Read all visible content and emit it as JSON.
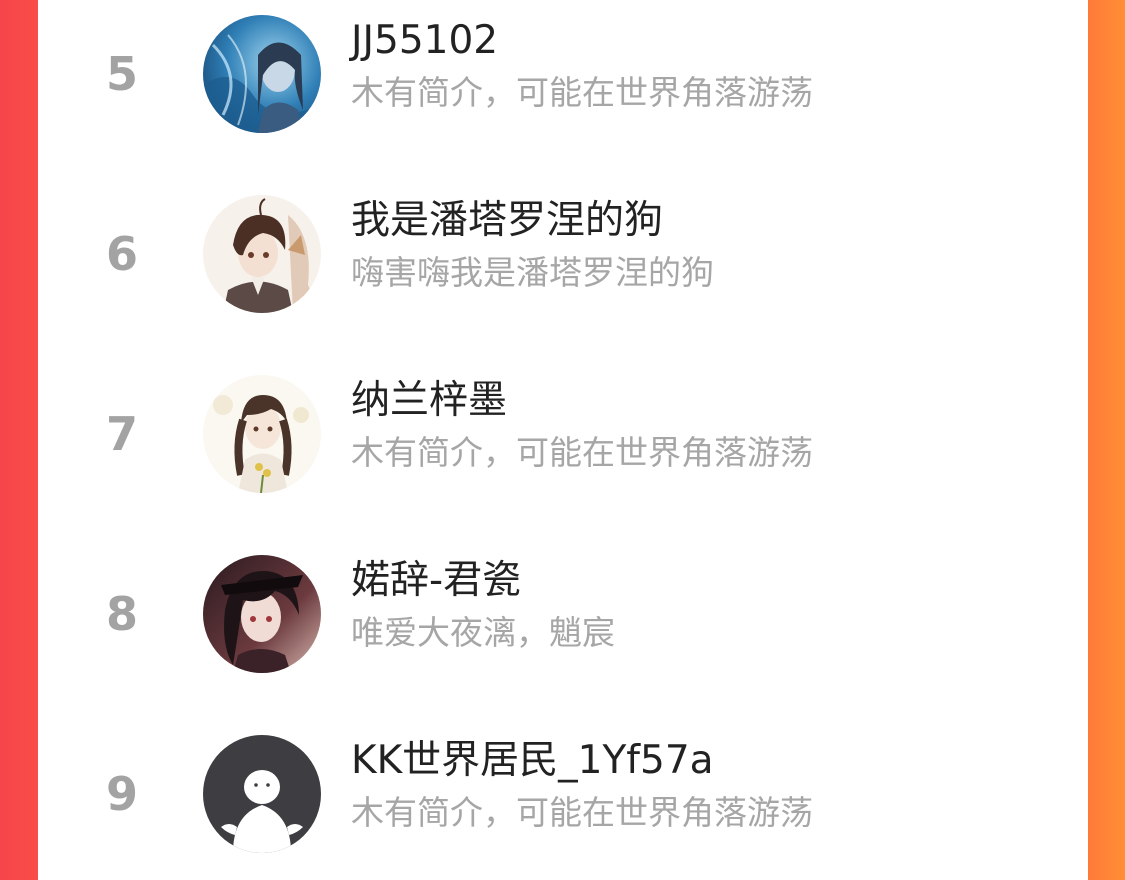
{
  "ranking": {
    "items": [
      {
        "rank": "5",
        "name": "JJ55102",
        "bio": "木有简介，可能在世界角落游荡",
        "avatar": "anime-avatar-blue-icon"
      },
      {
        "rank": "6",
        "name": "我是潘塔罗涅的狗",
        "bio": "嗨害嗨我是潘塔罗涅的狗",
        "avatar": "anime-avatar-boy-icon"
      },
      {
        "rank": "7",
        "name": "纳兰梓墨",
        "bio": "木有简介，可能在世界角落游荡",
        "avatar": "anime-avatar-girl-icon"
      },
      {
        "rank": "8",
        "name": "婼辞-君瓷",
        "bio": "唯爱大夜漓，魈宸",
        "avatar": "anime-avatar-dark-icon"
      },
      {
        "rank": "9",
        "name": "KK世界居民_1Yf57a",
        "bio": "木有简介，可能在世界角落游荡",
        "avatar": "default-user-avatar-icon"
      }
    ]
  },
  "colors": {
    "left_edge": "#f7454b",
    "right_edge": "#ff8e34",
    "rank_text": "#a3a3a3",
    "name_text": "#222222",
    "bio_text": "#a6a6a6"
  }
}
